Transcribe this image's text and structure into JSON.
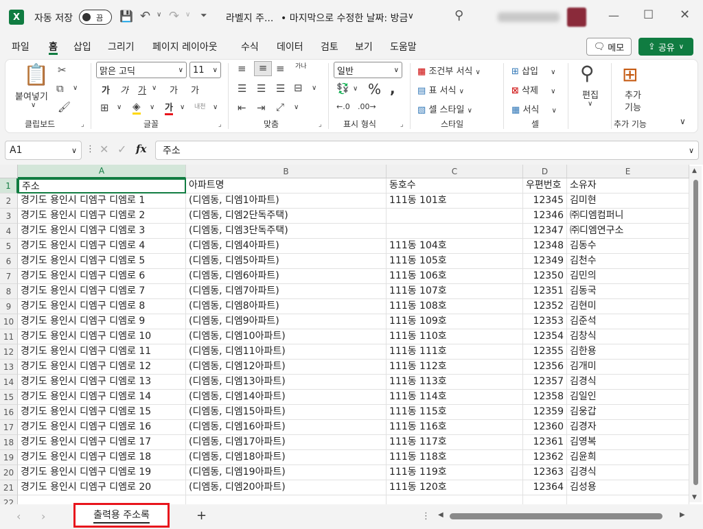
{
  "app": {
    "autosave_label": "자동 저장",
    "autosave_state": "끔",
    "doc_title": "라벨지 주...",
    "doc_status": "• 마지막으로 수정한 날짜: 방금",
    "caret": "∨"
  },
  "menu": [
    "파일",
    "홈",
    "삽입",
    "그리기",
    "페이지 레이아웃",
    "수식",
    "데이터",
    "검토",
    "보기",
    "도움말"
  ],
  "memo_label": "메모",
  "share_label": "공유",
  "ribbon": {
    "clipboard": {
      "paste": "붙여넣기",
      "group": "클립보드"
    },
    "font": {
      "name": "맑은 고딕",
      "size": "11",
      "group": "글꼴",
      "bold": "가",
      "italic": "가",
      "underline": "가",
      "grow": "가",
      "shrink": "가",
      "color": "가",
      "phon": "내천"
    },
    "align": {
      "group": "맞춤",
      "wrap": "가나"
    },
    "number": {
      "format": "일반",
      "group": "표시 형식",
      "percent": "%"
    },
    "styles": {
      "cond": "조건부 서식",
      "table": "표 서식",
      "cell": "셀 스타일",
      "group": "스타일"
    },
    "cells": {
      "insert": "삽입",
      "delete": "삭제",
      "format": "서식",
      "group": "셀"
    },
    "edit": {
      "label": "편집"
    },
    "addins": {
      "label": "추가 기능",
      "label2": "기능",
      "label1": "추가",
      "group": "추가 기능"
    }
  },
  "formula_bar": {
    "namebox": "A1",
    "fx": "fx",
    "content": "주소"
  },
  "columns": [
    "A",
    "B",
    "C",
    "D",
    "E"
  ],
  "rows": [
    [
      "주소",
      "아파트명",
      "동호수",
      "우편번호",
      "소유자"
    ],
    [
      "경기도 용인시 디엠구 디엠로 1",
      "(디엠동, 디엠1아파트)",
      "111동 101호",
      "12345",
      "김미현"
    ],
    [
      "경기도 용인시 디엠구 디엠로 2",
      "(디엠동, 디엠2단독주택)",
      "",
      "12346",
      "㈜디엠컴퍼니"
    ],
    [
      "경기도 용인시 디엠구 디엠로 3",
      "(디엠동, 디엠3단독주택)",
      "",
      "12347",
      "㈜디엠연구소"
    ],
    [
      "경기도 용인시 디엠구 디엠로 4",
      "(디엠동, 디엠4아파트)",
      "111동 104호",
      "12348",
      "김동수"
    ],
    [
      "경기도 용인시 디엠구 디엠로 5",
      "(디엠동, 디엠5아파트)",
      "111동 105호",
      "12349",
      "김천수"
    ],
    [
      "경기도 용인시 디엠구 디엠로 6",
      "(디엠동, 디엠6아파트)",
      "111동 106호",
      "12350",
      "김민의"
    ],
    [
      "경기도 용인시 디엠구 디엠로 7",
      "(디엠동, 디엠7아파트)",
      "111동 107호",
      "12351",
      "김동국"
    ],
    [
      "경기도 용인시 디엠구 디엠로 8",
      "(디엠동, 디엠8아파트)",
      "111동 108호",
      "12352",
      "김현미"
    ],
    [
      "경기도 용인시 디엠구 디엠로 9",
      "(디엠동, 디엠9아파트)",
      "111동 109호",
      "12353",
      "김준석"
    ],
    [
      "경기도 용인시 디엠구 디엠로 10",
      "(디엠동, 디엠10아파트)",
      "111동 110호",
      "12354",
      "김창식"
    ],
    [
      "경기도 용인시 디엠구 디엠로 11",
      "(디엠동, 디엠11아파트)",
      "111동 111호",
      "12355",
      "김한용"
    ],
    [
      "경기도 용인시 디엠구 디엠로 12",
      "(디엠동, 디엠12아파트)",
      "111동 112호",
      "12356",
      "김개미"
    ],
    [
      "경기도 용인시 디엠구 디엠로 13",
      "(디엠동, 디엠13아파트)",
      "111동 113호",
      "12357",
      "김경식"
    ],
    [
      "경기도 용인시 디엠구 디엠로 14",
      "(디엠동, 디엠14아파트)",
      "111동 114호",
      "12358",
      "김일인"
    ],
    [
      "경기도 용인시 디엠구 디엠로 15",
      "(디엠동, 디엠15아파트)",
      "111동 115호",
      "12359",
      "김웅갑"
    ],
    [
      "경기도 용인시 디엠구 디엠로 16",
      "(디엠동, 디엠16아파트)",
      "111동 116호",
      "12360",
      "김경자"
    ],
    [
      "경기도 용인시 디엠구 디엠로 17",
      "(디엠동, 디엠17아파트)",
      "111동 117호",
      "12361",
      "김영복"
    ],
    [
      "경기도 용인시 디엠구 디엠로 18",
      "(디엠동, 디엠18아파트)",
      "111동 118호",
      "12362",
      "김윤희"
    ],
    [
      "경기도 용인시 디엠구 디엠로 19",
      "(디엠동, 디엠19아파트)",
      "111동 119호",
      "12363",
      "김경식"
    ],
    [
      "경기도 용인시 디엠구 디엠로 20",
      "(디엠동, 디엠20아파트)",
      "111동 120호",
      "12364",
      "김성용"
    ],
    [
      "",
      "",
      "",
      "",
      ""
    ]
  ],
  "sheet_tab": "출력용 주소록",
  "add_sheet": "+",
  "colors": {
    "accent": "#107c41",
    "highlight": "#e8141c"
  }
}
